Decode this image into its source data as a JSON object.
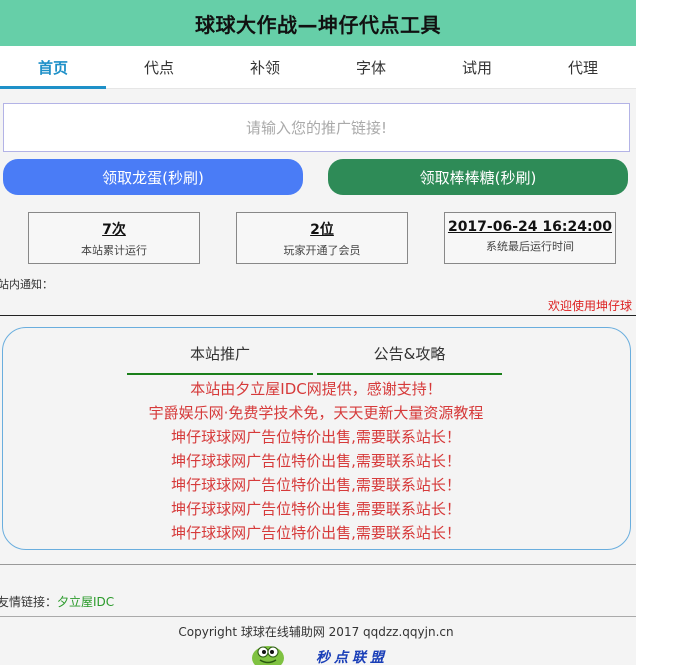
{
  "header": {
    "title": "球球大作战—坤仔代点工具"
  },
  "nav": {
    "items": [
      {
        "label": "首页",
        "active": true
      },
      {
        "label": "代点",
        "active": false
      },
      {
        "label": "补领",
        "active": false
      },
      {
        "label": "字体",
        "active": false
      },
      {
        "label": "试用",
        "active": false
      },
      {
        "label": "代理",
        "active": false
      }
    ]
  },
  "search": {
    "placeholder": "请输入您的推广链接!",
    "value": ""
  },
  "buttons": {
    "dragon_egg": "领取龙蛋(秒刷)",
    "lollipop": "领取棒棒糖(秒刷)"
  },
  "stats": [
    {
      "value": "7次",
      "label": "本站累计运行"
    },
    {
      "value": "2位",
      "label": "玩家开通了会员"
    },
    {
      "value": "2017-06-24 16:24:00",
      "label": "系统最后运行时间"
    }
  ],
  "notice": {
    "label": "站内通知：",
    "marquee": "欢迎使用坤仔球"
  },
  "panel": {
    "tabs": [
      "本站推广",
      "公告&攻略"
    ],
    "lines": [
      "本站由夕立屋IDC网提供，感谢支持！",
      "宇爵娱乐网·免费学技术免，天天更新大量资源教程",
      "坤仔球球网广告位特价出售,需要联系站长！",
      "坤仔球球网广告位特价出售,需要联系站长！",
      "坤仔球球网广告位特价出售,需要联系站长！",
      "坤仔球球网广告位特价出售,需要联系站长！",
      "坤仔球球网广告位特价出售,需要联系站长！"
    ]
  },
  "footer": {
    "friend_label": "友情链接：",
    "friend_link": "夕立屋IDC",
    "copyright": "Copyright 球球在线辅助网 2017 qqdzz.qqyjn.cn",
    "logo_text": "秒点联盟"
  },
  "colors": {
    "header_bg": "#66cfa8",
    "nav_active": "#1e90c8",
    "dragon_button": "#4a7cf6",
    "lollipop_button": "#2e8b57",
    "panel_text": "#d63a3a",
    "link": "#2a9a2a"
  }
}
